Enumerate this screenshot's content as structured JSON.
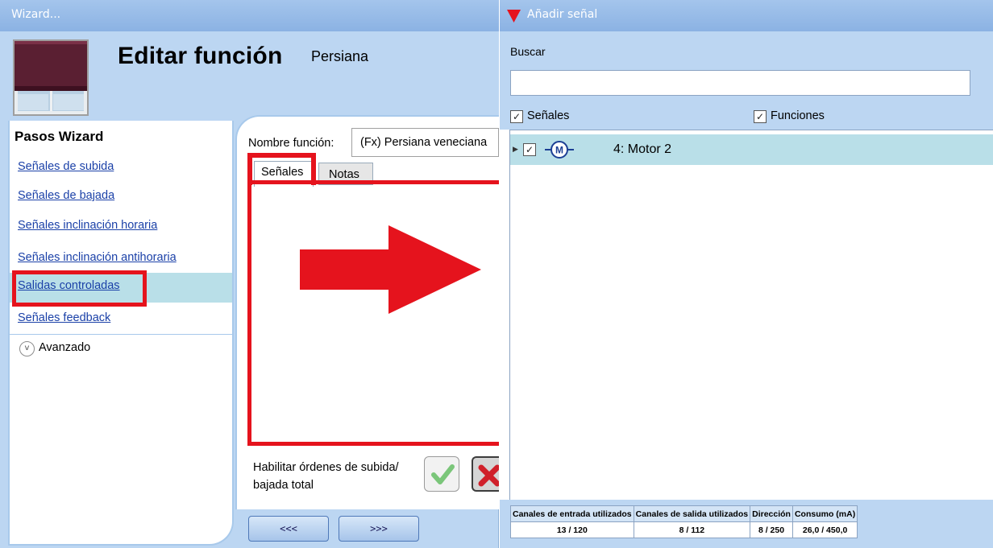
{
  "wizard": {
    "window_title": "Wizard...",
    "title": "Editar función",
    "subtitle": "Persiana",
    "steps_title": "Pasos Wizard",
    "steps": [
      {
        "label": "Señales de subida"
      },
      {
        "label": "Señales de bajada"
      },
      {
        "label": "Señales inclinación horaria"
      },
      {
        "label": "Señales inclinación antihoraria"
      },
      {
        "label": "Salidas controladas",
        "selected": true
      },
      {
        "label": "Señales feedback"
      }
    ],
    "advanced_label": "Avanzado",
    "function_name_label": "Nombre función:",
    "function_name_value": "(Fx) Persiana veneciana",
    "tabs": [
      {
        "label": "Señales",
        "active": true
      },
      {
        "label": "Notas",
        "active": false
      }
    ],
    "enable_label": "Habilitar órdenes de subida/ bajada total",
    "prev_button": "<<<",
    "next_button": ">>>",
    "highlight_color": "#e5131d"
  },
  "signal_panel": {
    "window_title": "Añadir señal",
    "search_label": "Buscar",
    "search_value": "",
    "filters": [
      {
        "label": "Señales",
        "checked": true
      },
      {
        "label": "Funciones",
        "checked": true
      }
    ],
    "items": [
      {
        "label": "4: Motor 2",
        "checked": true,
        "icon": "motor-icon"
      }
    ],
    "stats": {
      "headers": [
        "Canales de entrada utilizados",
        "Canales de salida utilizados",
        "Dirección",
        "Consumo (mA)"
      ],
      "values": [
        "13 / 120",
        "8 / 112",
        "8 / 250",
        "26,0 / 450,0"
      ]
    }
  }
}
